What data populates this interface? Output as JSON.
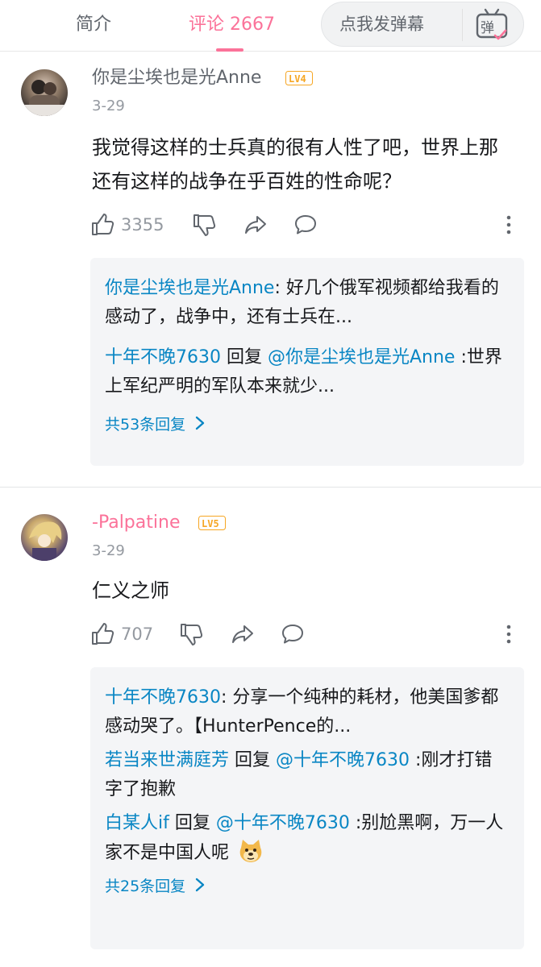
{
  "tabs": {
    "intro": "简介",
    "comments": "评论 2667"
  },
  "danmaku": {
    "placeholder": "点我发弹幕",
    "icon_label": "弹"
  },
  "comments": [
    {
      "user": "你是尘埃也是光Anne",
      "level": "LV4",
      "date": "3-29",
      "content": "我觉得这样的士兵真的很有人性了吧，世界上那还有这样的战争在乎百姓的性命呢？",
      "likes": "3355",
      "replies": [
        {
          "name": "你是尘埃也是光Anne",
          "text": ": 好几个俄军视频都给我看的感动了，战争中，还有士兵在..."
        },
        {
          "name": "十年不晚7630",
          "reply_word": " 回复 ",
          "mention": "@你是尘埃也是光Anne",
          "text": " :世界上军纪严明的军队本来就少..."
        }
      ],
      "total": "共53条回复"
    },
    {
      "user": "-Palpatine",
      "level": "LV5",
      "date": "3-29",
      "content": "仁义之师",
      "likes": "707",
      "replies": [
        {
          "name": "十年不晚7630",
          "text": ": 分享一个纯种的耗材，他美国爹都感动哭了。【HunterPence的..."
        },
        {
          "name": "若当来世满庭芳",
          "reply_word": " 回复 ",
          "mention": "@十年不晚7630",
          "text": " :刚才打错字了抱歉"
        },
        {
          "name": "白某人if",
          "reply_word": " 回复 ",
          "mention": "@十年不晚7630",
          "text": " :别尬黑啊，万一人家不是中国人呢"
        }
      ],
      "total": "共25条回复"
    }
  ],
  "colors": {
    "accent": "#fb7299",
    "link": "#0986c4",
    "secondary": "#9499a0",
    "level_badge": "#f6a623"
  }
}
